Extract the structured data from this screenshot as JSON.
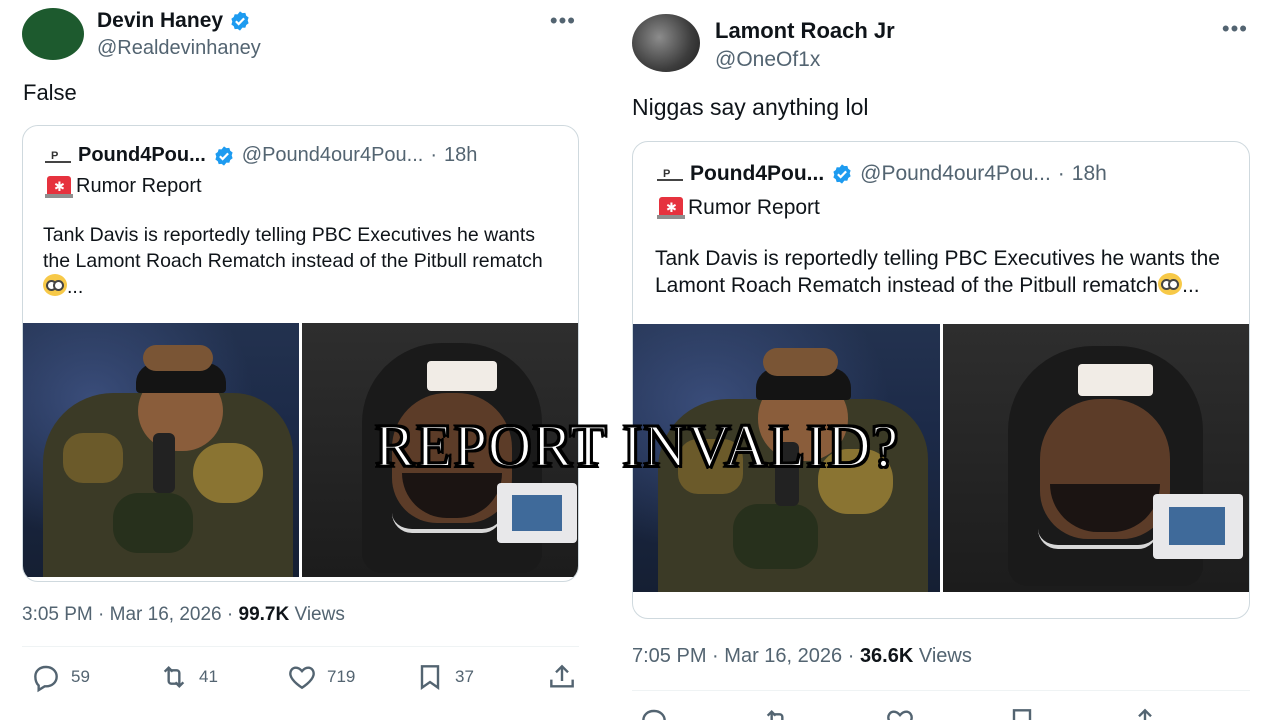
{
  "overlay": {
    "text": "REPORT INVALID?"
  },
  "colors": {
    "verified": "#1d9bf0",
    "text_primary": "#0f1419",
    "text_secondary": "#536471",
    "border": "#cfd9de",
    "siren": "#e6323e"
  },
  "left_tweet": {
    "author": {
      "display_name": "Devin Haney",
      "handle": "@Realdevinhaney",
      "verified": true
    },
    "more_icon": "•••",
    "text": "False",
    "quote": {
      "author_name": "Pound4Pou...",
      "handle": "@Pound4our4Pou...",
      "separator": "·",
      "time": "18h",
      "label": "Rumor Report",
      "body": "Tank Davis is reportedly telling PBC Executives he wants the Lamont Roach Rematch instead of the Pitbull rematch",
      "ellipsis": "..."
    },
    "meta": {
      "time": "3:05 PM",
      "separator1": "·",
      "date": "Mar 16, 2026",
      "separator2": "·",
      "views_count": "99.7K",
      "views_label": "Views"
    },
    "actions": {
      "replies": "59",
      "reposts": "41",
      "likes": "719",
      "bookmarks": "37"
    }
  },
  "right_tweet": {
    "author": {
      "display_name": "Lamont Roach Jr",
      "handle": "@OneOf1x",
      "verified": false
    },
    "more_icon": "•••",
    "text": "Niggas say anything lol",
    "quote": {
      "author_name": "Pound4Pou...",
      "handle": "@Pound4our4Pou...",
      "separator": "·",
      "time": "18h",
      "label": "Rumor Report",
      "body": "Tank Davis is reportedly telling PBC Executives he wants the Lamont Roach Rematch instead of the Pitbull rematch",
      "ellipsis": "..."
    },
    "meta": {
      "time": "7:05 PM",
      "separator1": "·",
      "date": "Mar 16, 2026",
      "separator2": "·",
      "views_count": "36.6K",
      "views_label": "Views"
    }
  }
}
